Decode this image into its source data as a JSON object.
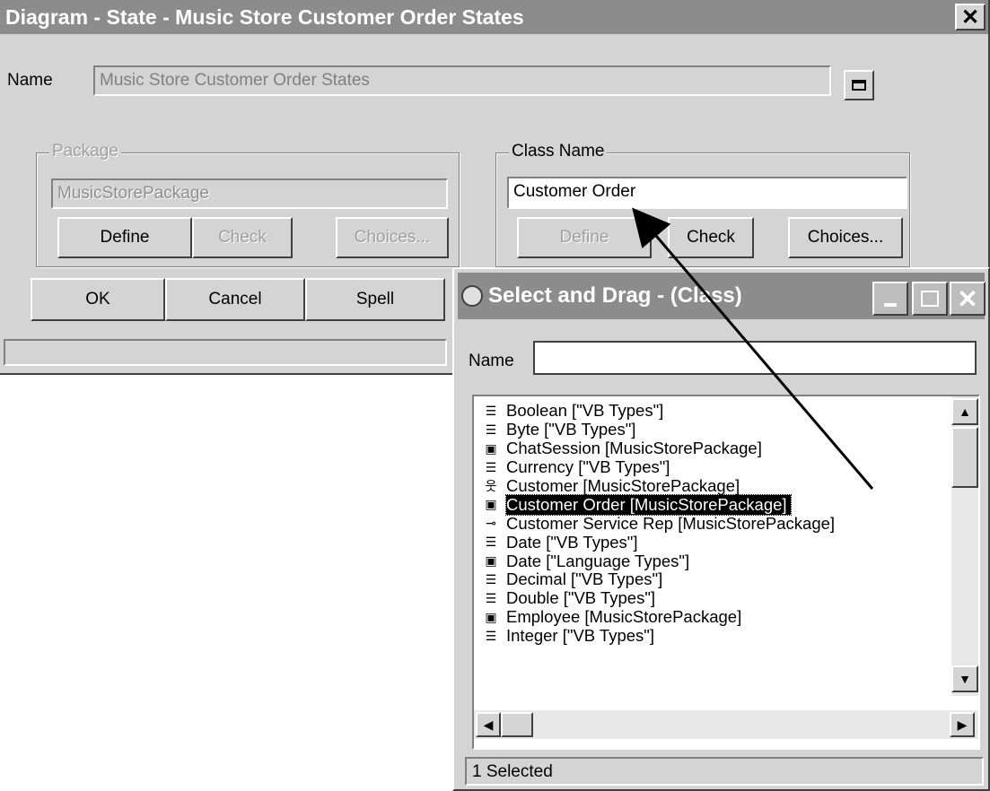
{
  "main_dialog": {
    "title": "Diagram - State - Music Store Customer Order States",
    "name_label": "Name",
    "name_value": "Music Store Customer Order States",
    "package_group": {
      "label": "Package",
      "value": "MusicStorePackage",
      "define_label": "Define",
      "check_label": "Check",
      "choices_label": "Choices..."
    },
    "class_group": {
      "label": "Class Name",
      "value": "Customer Order",
      "define_label": "Define",
      "check_label": "Check",
      "choices_label": "Choices..."
    },
    "ok_label": "OK",
    "cancel_label": "Cancel",
    "spell_label": "Spell"
  },
  "drag_dialog": {
    "title": "Select and Drag - (Class)",
    "name_label": "Name",
    "name_value": "",
    "items": [
      {
        "label": "Boolean [\"VB Types\"]",
        "icon": "type-icon",
        "selected": false
      },
      {
        "label": "Byte [\"VB Types\"]",
        "icon": "type-icon",
        "selected": false
      },
      {
        "label": "ChatSession [MusicStorePackage]",
        "icon": "class-icon",
        "selected": false
      },
      {
        "label": "Currency [\"VB Types\"]",
        "icon": "type-icon",
        "selected": false
      },
      {
        "label": "Customer [MusicStorePackage]",
        "icon": "actor-icon",
        "selected": false
      },
      {
        "label": "Customer Order [MusicStorePackage]",
        "icon": "class-icon",
        "selected": true
      },
      {
        "label": "Customer Service Rep [MusicStorePackage]",
        "icon": "interface-icon",
        "selected": false
      },
      {
        "label": "Date [\"VB Types\"]",
        "icon": "type-icon",
        "selected": false
      },
      {
        "label": "Date [\"Language Types\"]",
        "icon": "class-icon",
        "selected": false
      },
      {
        "label": "Decimal [\"VB Types\"]",
        "icon": "type-icon",
        "selected": false
      },
      {
        "label": "Double [\"VB Types\"]",
        "icon": "type-icon",
        "selected": false
      },
      {
        "label": "Employee [MusicStorePackage]",
        "icon": "class-icon",
        "selected": false
      },
      {
        "label": "Integer [\"VB Types\"]",
        "icon": "type-icon",
        "selected": false
      }
    ],
    "status": "1 Selected"
  }
}
